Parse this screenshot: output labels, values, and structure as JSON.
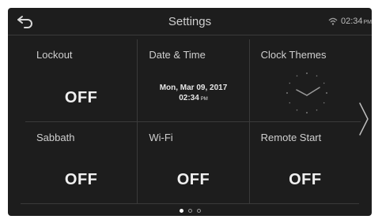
{
  "header": {
    "title": "Settings",
    "back_icon": "back-arrow-icon",
    "wifi_icon": "wifi-icon",
    "time": "02:34",
    "ampm": "PM"
  },
  "tiles": [
    {
      "label": "Lockout",
      "value": "OFF"
    },
    {
      "label": "Date & Time",
      "date_line": "Mon, Mar 09, 2017",
      "time_line": "02:34",
      "ampm": "PM"
    },
    {
      "label": "Clock Themes",
      "icon": "analog-clock-icon"
    },
    {
      "label": "Sabbath",
      "value": "OFF"
    },
    {
      "label": "Wi-Fi",
      "value": "OFF"
    },
    {
      "label": "Remote Start",
      "value": "OFF"
    }
  ],
  "pager": {
    "pages": 3,
    "current": 1
  },
  "navigation": {
    "next_icon": "chevron-right-icon"
  },
  "colors": {
    "background": "#1d1d1d",
    "text": "#d8d8d8",
    "divider": "#3a3a3a"
  }
}
